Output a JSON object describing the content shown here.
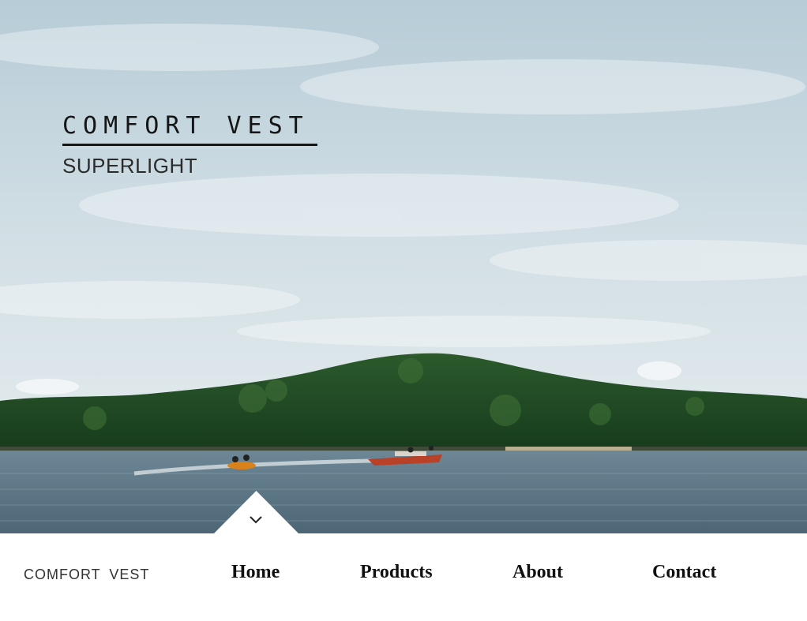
{
  "hero": {
    "title": "COMFORT VEST",
    "subtitle": "SUPERLIGHT"
  },
  "scroll_indicator": {
    "icon": "chevron-down-icon"
  },
  "navbar": {
    "brand": "COMFORT VEST",
    "items": [
      {
        "label": "Home"
      },
      {
        "label": "Products"
      },
      {
        "label": "About"
      },
      {
        "label": "Contact"
      }
    ]
  },
  "colors": {
    "sky_top": "#b8cdd8",
    "sky_bottom": "#e7eef0",
    "trees": "#1f4a24",
    "water": "#5c7584",
    "boat": "#c0452c",
    "text": "#151515",
    "navbar_bg": "#ffffff"
  }
}
